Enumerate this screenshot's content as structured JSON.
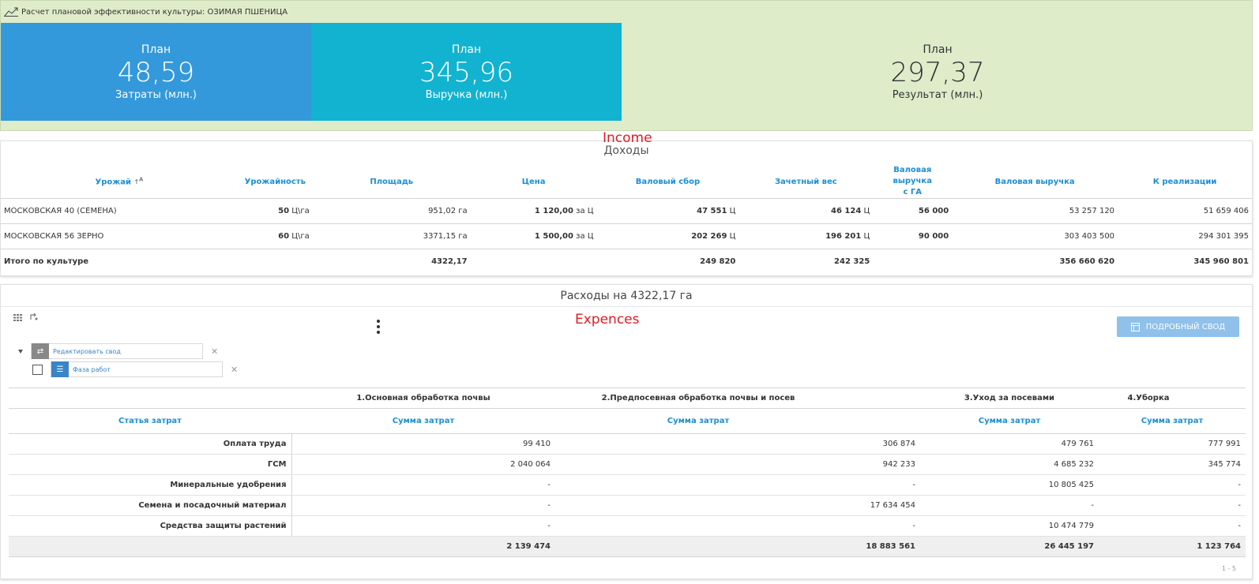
{
  "header": {
    "title": "Расчет плановой эффективности культуры: ОЗИМАЯ ПШЕНИЦА"
  },
  "kpis": [
    {
      "top": "План",
      "value": "48,59",
      "label": "Затраты (млн.)"
    },
    {
      "top": "План",
      "value": "345,96",
      "label": "Выручка (млн.)"
    },
    {
      "top": "План",
      "value": "297,37",
      "label": "Результат (млн.)"
    }
  ],
  "colors": {
    "costs_tile": "#3399db",
    "revenue_tile": "#12b3d0",
    "panel_bg": "#deecca",
    "link_blue": "#1a8fd6",
    "annotation_red": "#e01b24"
  },
  "income": {
    "annotation": "Income",
    "title": "Доходы",
    "columns": [
      "Урожай",
      "Урожайность",
      "Площадь",
      "Цена",
      "Валовый сбор",
      "Зачетный вес",
      "Валовая выручка с ГА",
      "Валовая выручка",
      "К реализации"
    ],
    "rows": [
      {
        "crop": "МОСКОВСКАЯ 40 (СЕМЕНА)",
        "yield": "50",
        "yield_unit": "Ц\\га",
        "area": "951,02 га",
        "price": "1 120,00",
        "price_unit": "за Ц",
        "gross": "47 551",
        "gross_unit": "Ц",
        "credit": "46 124",
        "credit_unit": "Ц",
        "rev_ha": "56 000",
        "revenue": "53 257 120",
        "sale": "51 659 406"
      },
      {
        "crop": "МОСКОВСКАЯ 56 ЗЕРНО",
        "yield": "60",
        "yield_unit": "Ц\\га",
        "area": "3371,15 га",
        "price": "1 500,00",
        "price_unit": "за Ц",
        "gross": "202 269",
        "gross_unit": "Ц",
        "credit": "196 201",
        "credit_unit": "Ц",
        "rev_ha": "90 000",
        "revenue": "303 403 500",
        "sale": "294 301 395"
      }
    ],
    "total": {
      "label": "Итого по культуре",
      "area": "4322,17",
      "gross": "249 820",
      "credit": "242 325",
      "revenue": "356 660 620",
      "sale": "345 960 801"
    }
  },
  "expenses": {
    "title": "Расходы на 4322,17 га",
    "annotation": "Expences",
    "detail_button": "ПОДРОБНЫЙ СВОД",
    "filters": {
      "edit": "Редактировать свод",
      "phase": "Фаза работ"
    },
    "phases": [
      "1.Основная обработка почвы",
      "2.Предпосевная обработка почвы и посев",
      "3.Уход за посевами",
      "4.Уборка"
    ],
    "row_header": "Статья затрат",
    "sum_header": "Сумма затрат",
    "rows": [
      {
        "name": "Оплата труда",
        "values": [
          "99 410",
          "306 874",
          "479 761",
          "777 991"
        ]
      },
      {
        "name": "ГСМ",
        "values": [
          "2 040 064",
          "942 233",
          "4 685 232",
          "345 774"
        ]
      },
      {
        "name": "Минеральные удобрения",
        "values": [
          "-",
          "-",
          "10 805 425",
          "-"
        ]
      },
      {
        "name": "Семена и посадочный материал",
        "values": [
          "-",
          "17 634 454",
          "-",
          "-"
        ]
      },
      {
        "name": "Средства защиты растений",
        "values": [
          "-",
          "-",
          "10 474 779",
          "-"
        ]
      }
    ],
    "totals": [
      "2 139 474",
      "18 883 561",
      "26 445 197",
      "1 123 764"
    ],
    "pager": "1 - 5"
  }
}
